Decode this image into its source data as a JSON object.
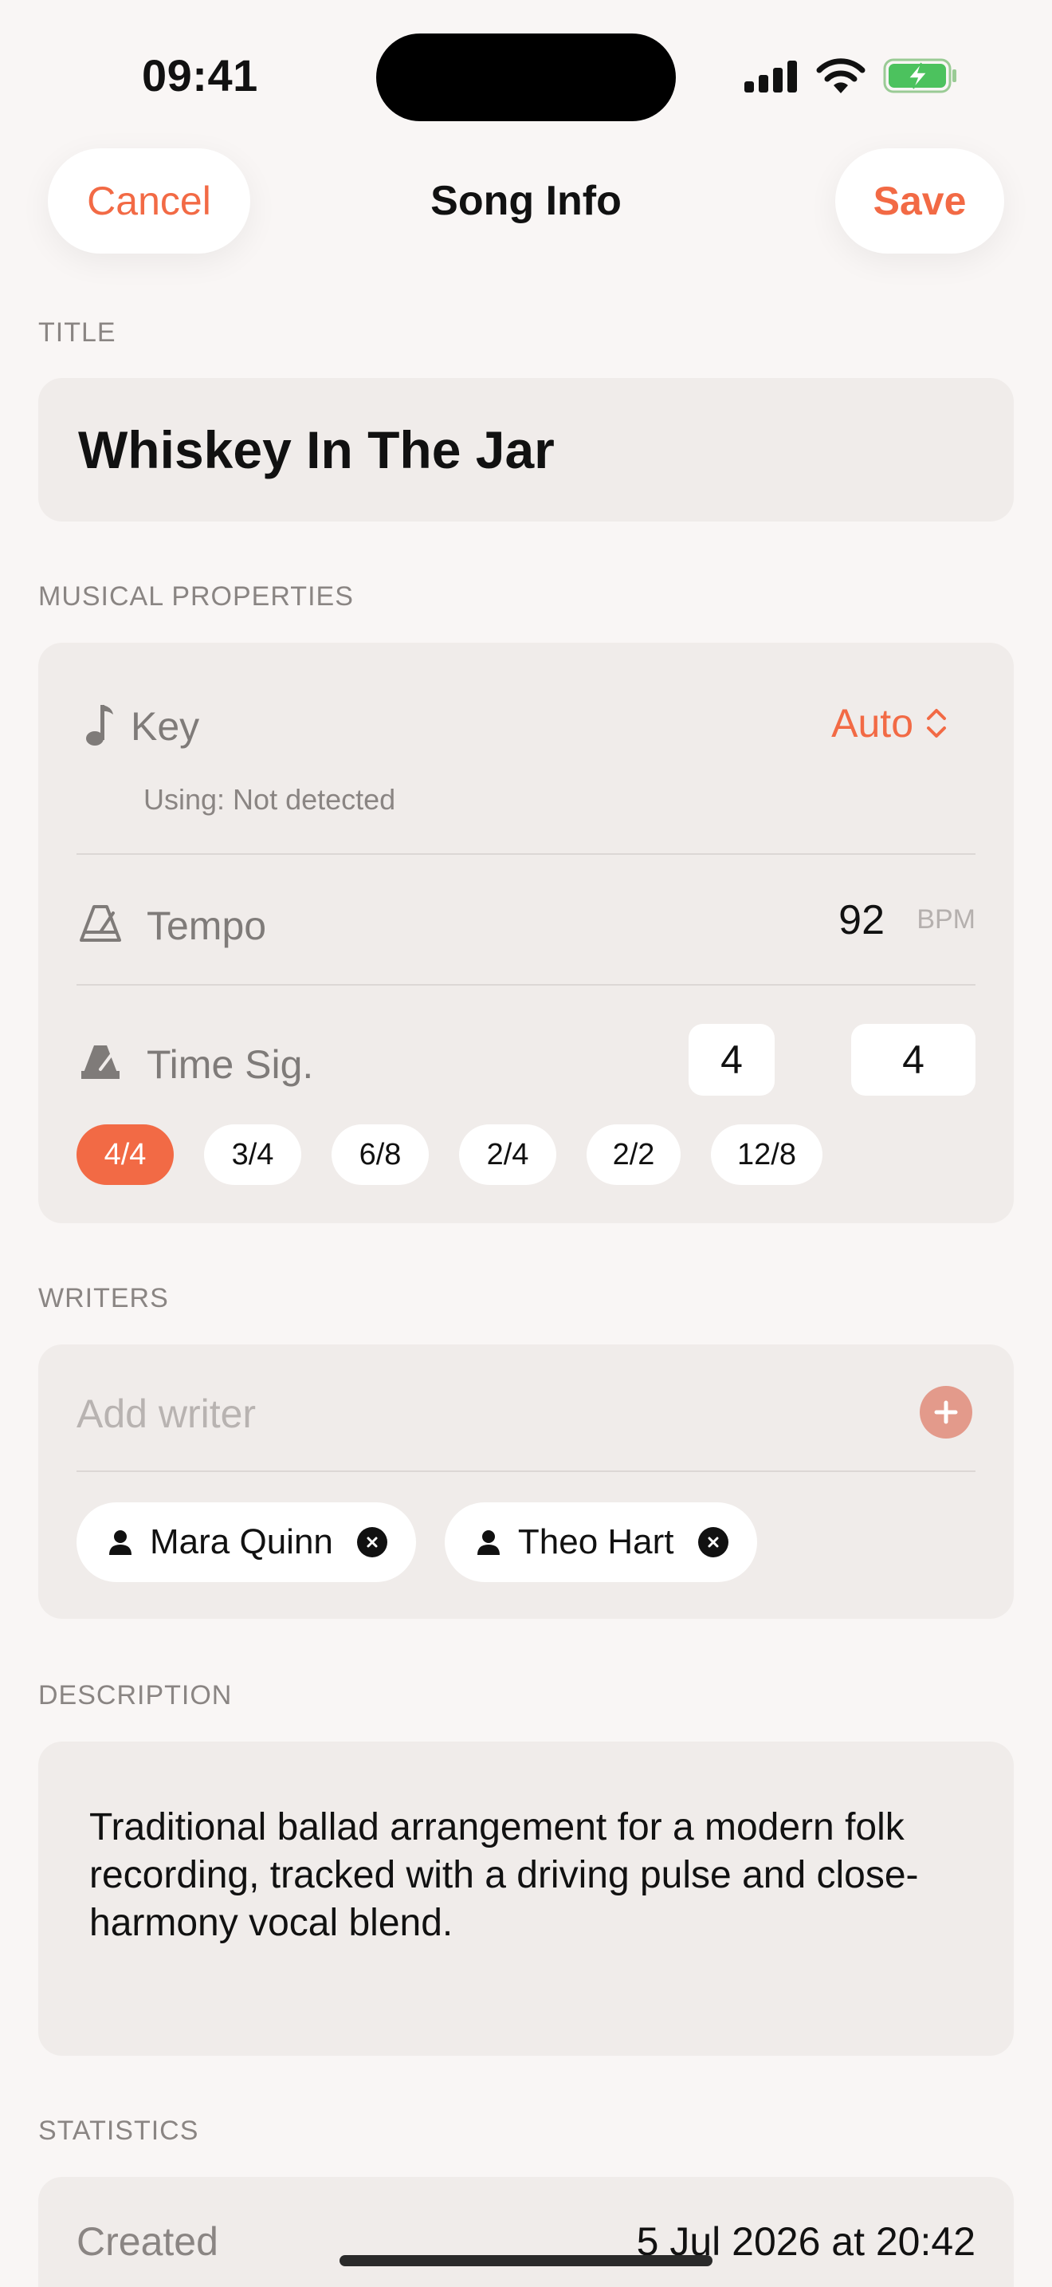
{
  "status": {
    "time": "09:41"
  },
  "nav": {
    "cancel": "Cancel",
    "title": "Song Info",
    "save": "Save"
  },
  "title_section": {
    "label": "TITLE",
    "value": "Whiskey In The Jar"
  },
  "musical": {
    "label": "MUSICAL PROPERTIES",
    "key": {
      "label": "Key",
      "value": "Auto",
      "sub": "Using: Not detected"
    },
    "tempo": {
      "label": "Tempo",
      "value": "92",
      "unit": "BPM"
    },
    "time_sig": {
      "label": "Time Sig.",
      "numerator": "4",
      "slash": "/",
      "denominator": "4",
      "presets": [
        "4/4",
        "3/4",
        "6/8",
        "2/4",
        "2/2",
        "12/8"
      ],
      "selected": "4/4"
    }
  },
  "writers": {
    "label": "WRITERS",
    "placeholder": "Add writer",
    "list": [
      "Mara Quinn",
      "Theo Hart"
    ]
  },
  "description": {
    "label": "DESCRIPTION",
    "text": "Traditional ballad arrangement for a modern folk recording, tracked with a driving pulse and close-harmony vocal blend."
  },
  "statistics": {
    "label": "STATISTICS",
    "created_label": "Created",
    "created_value": "5 Jul 2026 at 20:42"
  },
  "colors": {
    "accent": "#F26A45",
    "background": "#F9F6F5",
    "card": "#F0ECEA"
  },
  "icons": [
    "signal-icon",
    "wifi-icon",
    "battery-charging-icon",
    "music-note-icon",
    "metronome-icon",
    "metronome-filled-icon",
    "plus-icon",
    "person-icon",
    "close-icon",
    "chevron-updown-icon"
  ]
}
